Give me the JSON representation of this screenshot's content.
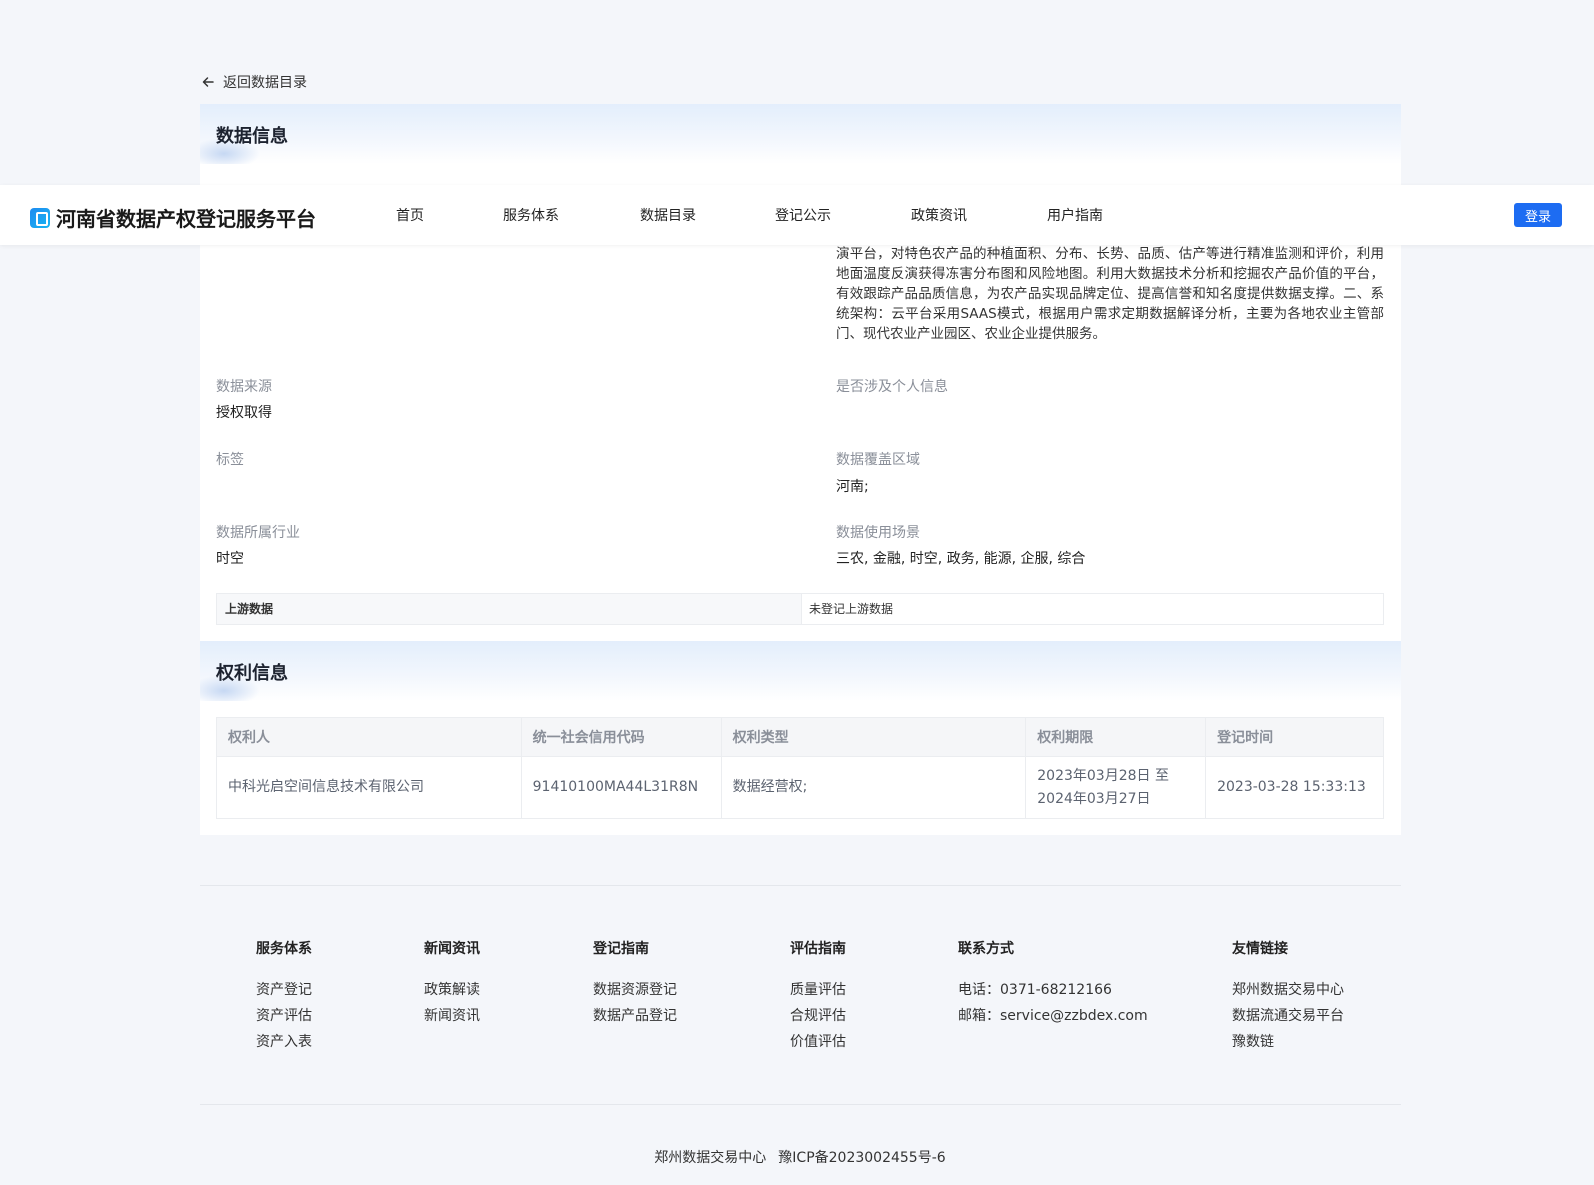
{
  "back_link": "返回数据目录",
  "header": {
    "logo_text": "河南省数据产权登记服务平台",
    "nav": [
      "首页",
      "服务体系",
      "数据目录",
      "登记公示",
      "政策资讯",
      "用户指南"
    ],
    "login": "登录"
  },
  "data_info": {
    "title": "数据信息",
    "description": "演平台，对特色农产品的种植面积、分布、长势、品质、估产等进行精准监测和评价，利用地面温度反演获得冻害分布图和风险地图。利用大数据技术分析和挖掘农产品价值的平台，有效跟踪产品品质信息，为农产品实现品牌定位、提高信誉和知名度提供数据支撑。二、系统架构：云平台采用SAAS模式，根据用户需求定期数据解译分析，主要为各地农业主管部门、现代农业产业园区、农业企业提供服务。",
    "source_label": "数据来源",
    "source_value": "授权取得",
    "personal_label": "是否涉及个人信息",
    "tags_label": "标签",
    "coverage_label": "数据覆盖区域",
    "coverage_value": "河南;",
    "industry_label": "数据所属行业",
    "industry_value": "时空",
    "scenario_label": "数据使用场景",
    "scenario_value": "三农, 金融, 时空, 政务, 能源, 企服, 综合",
    "upstream_label": "上游数据",
    "upstream_value": "未登记上游数据"
  },
  "rights_info": {
    "title": "权利信息",
    "columns": [
      "权利人",
      "统一社会信用代码",
      "权利类型",
      "权利期限",
      "登记时间"
    ],
    "rows": [
      {
        "holder": "中科光启空间信息技术有限公司",
        "credit_code": "91410100MA44L31R8N",
        "type": "数据经营权;",
        "term_start": "2023年03月28日 至",
        "term_end": "2024年03月27日",
        "registered": "2023-03-28 15:33:13"
      }
    ]
  },
  "footer": {
    "service": {
      "title": "服务体系",
      "links": [
        "资产登记",
        "资产评估",
        "资产入表"
      ]
    },
    "news": {
      "title": "新闻资讯",
      "links": [
        "政策解读",
        "新闻资讯"
      ]
    },
    "register_guide": {
      "title": "登记指南",
      "links": [
        "数据资源登记",
        "数据产品登记"
      ]
    },
    "eval_guide": {
      "title": "评估指南",
      "links": [
        "质量评估",
        "合规评估",
        "价值评估"
      ]
    },
    "contact": {
      "title": "联系方式",
      "phone": "电话：0371-68212166",
      "email": "邮箱：service@zzbdex.com"
    },
    "friends": {
      "title": "友情链接",
      "links": [
        "郑州数据交易中心",
        "数据流通交易平台",
        "豫数链"
      ]
    },
    "org": "郑州数据交易中心",
    "icp": "豫ICP备2023002455号-6"
  }
}
